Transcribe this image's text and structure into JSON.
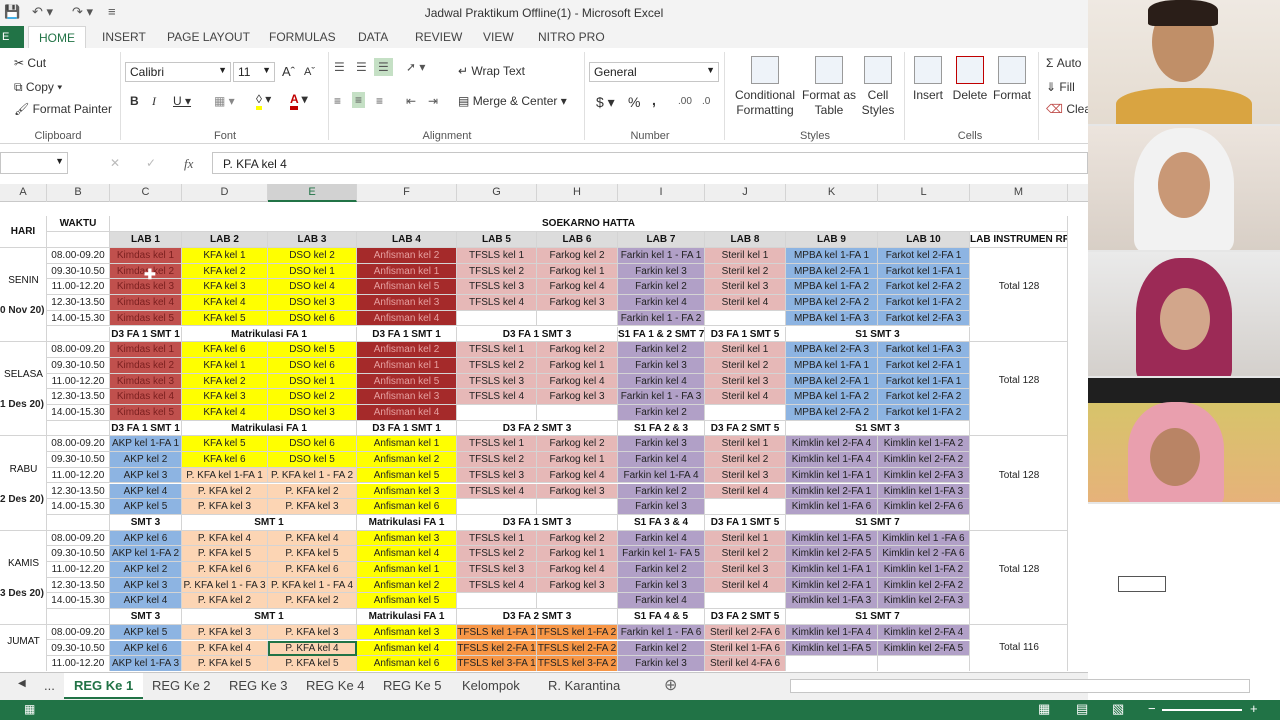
{
  "window": {
    "title": "Jadwal Praktikum Offline(1) - Microsoft Excel"
  },
  "tabs": [
    "HOME",
    "INSERT",
    "PAGE LAYOUT",
    "FORMULAS",
    "DATA",
    "REVIEW",
    "VIEW",
    "NITRO PRO"
  ],
  "file_tab": "E",
  "ribbon": {
    "cut": "Cut",
    "copy": "Copy",
    "format_painter": "Format Painter",
    "font": "Calibri",
    "size": "11",
    "wrap": "Wrap Text",
    "merge": "Merge & Center",
    "number_format": "General",
    "conditional": "Conditional Formatting",
    "format_table": "Format as Table",
    "cell_styles": "Cell Styles",
    "insert": "Insert",
    "delete": "Delete",
    "format": "Format",
    "autosum": "Auto",
    "fill": "Fill",
    "clear": "Clea",
    "groups": {
      "clipboard": "Clipboard",
      "font": "Font",
      "alignment": "Alignment",
      "number": "Number",
      "styles": "Styles",
      "cells": "Cells"
    }
  },
  "formula_bar": {
    "fx": "fx",
    "value": "P. KFA kel 4"
  },
  "columns": [
    "A",
    "B",
    "C",
    "D",
    "E",
    "F",
    "G",
    "H",
    "I",
    "J",
    "K",
    "L",
    "M"
  ],
  "header": {
    "hari": "HARI",
    "waktu": "WAKTU",
    "campus": "SOEKARNO HATTA",
    "labs": [
      "LAB 1",
      "LAB 2",
      "LAB 3",
      "LAB 4",
      "LAB 5",
      "LAB 6",
      "LAB 7",
      "LAB 8",
      "LAB 9",
      "LAB 10",
      "LAB INSTRUMEN RF"
    ]
  },
  "times": [
    "08.00-09.20",
    "09.30-10.50",
    "11.00-12.20",
    "12.30-13.50",
    "14.00-15.30"
  ],
  "days": [
    {
      "name": "SENIN",
      "date": "0 Nov 20)",
      "total": "Total 128",
      "rows": [
        [
          "Kimdas kel 1",
          "KFA kel 1",
          "DSO kel 2",
          "Anfisman kel 2",
          "TFSLS kel 1",
          "Farkog kel 2",
          "Farkin kel 1 - FA 1",
          "Steril kel 1",
          "MPBA kel 1-FA 1",
          "Farkot kel 2-FA 1"
        ],
        [
          "Kimdas kel 2",
          "KFA kel 2",
          "DSO kel 1",
          "Anfisman kel 1",
          "TFSLS kel 2",
          "Farkog kel 1",
          "Farkin kel 3",
          "Steril kel 2",
          "MPBA kel 2-FA 1",
          "Farkot kel 1-FA 1"
        ],
        [
          "Kimdas kel 3",
          "KFA kel 3",
          "DSO kel 4",
          "Anfisman kel 5",
          "TFSLS kel 3",
          "Farkog kel 4",
          "Farkin kel 2",
          "Steril kel 3",
          "MPBA kel 1-FA 2",
          "Farkot kel 2-FA 2"
        ],
        [
          "Kimdas kel 4",
          "KFA kel 4",
          "DSO kel 3",
          "Anfisman kel 3",
          "TFSLS kel 4",
          "Farkog kel 3",
          "Farkin kel 4",
          "Steril kel 4",
          "MPBA kel 2-FA 2",
          "Farkot kel 1-FA 2"
        ],
        [
          "Kimdas kel 5",
          "KFA kel 5",
          "DSO kel 6",
          "Anfisman kel 4",
          "",
          "",
          "Farkin kel 1 - FA 2",
          "",
          "MPBA kel 1-FA 3",
          "Farkot kel 2-FA 3"
        ]
      ],
      "footer": [
        "D3 FA 1 SMT 1",
        "Matrikulasi FA 1",
        "D3 FA 1 SMT 1",
        "D3 FA 1 SMT 3",
        "S1 FA 1 & 2 SMT 7",
        "D3 FA 1 SMT 5",
        "S1 SMT 3"
      ]
    },
    {
      "name": "SELASA",
      "date": "1 Des 20)",
      "total": "Total 128",
      "rows": [
        [
          "Kimdas kel 1",
          "KFA kel 6",
          "DSO kel 5",
          "Anfisman kel 2",
          "TFSLS kel 1",
          "Farkog kel 2",
          "Farkin kel 2",
          "Steril kel 1",
          "MPBA kel 2-FA 3",
          "Farkot kel 1-FA 3"
        ],
        [
          "Kimdas kel 2",
          "KFA kel 1",
          "DSO kel 6",
          "Anfisman kel 1",
          "TFSLS kel 2",
          "Farkog kel 1",
          "Farkin kel 3",
          "Steril kel 2",
          "MPBA kel 1-FA 1",
          "Farkot kel 2-FA 1"
        ],
        [
          "Kimdas kel 3",
          "KFA kel 2",
          "DSO kel 1",
          "Anfisman kel 5",
          "TFSLS kel 3",
          "Farkog kel 4",
          "Farkin kel 4",
          "Steril kel 3",
          "MPBA kel 2-FA 1",
          "Farkot kel 1-FA 1"
        ],
        [
          "Kimdas kel 4",
          "KFA kel 3",
          "DSO kel 2",
          "Anfisman kel 3",
          "TFSLS kel 4",
          "Farkog kel 3",
          "Farkin kel 1 - FA 3",
          "Steril kel 4",
          "MPBA kel 1-FA 2",
          "Farkot kel 2-FA 2"
        ],
        [
          "Kimdas kel 5",
          "KFA kel 4",
          "DSO kel 3",
          "Anfisman kel 4",
          "",
          "",
          "Farkin kel 2",
          "",
          "MPBA kel 2-FA 2",
          "Farkot kel 1-FA 2"
        ]
      ],
      "footer": [
        "D3 FA 1 SMT 1",
        "Matrikulasi FA 1",
        "D3 FA 1 SMT 1",
        "D3 FA 2 SMT 3",
        "S1 FA 2 & 3",
        "D3 FA 2 SMT 5",
        "S1 SMT 3"
      ]
    },
    {
      "name": "RABU",
      "date": "2 Des 20)",
      "total": "Total 128",
      "rows": [
        [
          "AKP kel 1-FA 1",
          "KFA kel 5",
          "DSO kel 6",
          "Anfisman kel 1",
          "TFSLS kel 1",
          "Farkog kel 2",
          "Farkin kel 3",
          "Steril kel 1",
          "Kimklin kel 2-FA 4",
          "Kimklin kel 1-FA 2"
        ],
        [
          "AKP kel 2",
          "KFA kel 6",
          "DSO kel 5",
          "Anfisman kel 2",
          "TFSLS kel 2",
          "Farkog kel 1",
          "Farkin kel 4",
          "Steril kel 2",
          "Kimklin kel 1-FA 4",
          "Kimklin kel 2-FA 2"
        ],
        [
          "AKP kel 3",
          "P. KFA kel 1-FA 1",
          "P. KFA kel 1 - FA 2",
          "Anfisman kel 5",
          "TFSLS kel 3",
          "Farkog kel 4",
          "Farkin kel 1-FA 4",
          "Steril kel 3",
          "Kimklin kel 1-FA 1",
          "Kimklin kel 2-FA 3"
        ],
        [
          "AKP kel 4",
          "P. KFA kel 2",
          "P. KFA kel 2",
          "Anfisman kel 3",
          "TFSLS kel 4",
          "Farkog kel 3",
          "Farkin kel 2",
          "Steril kel 4",
          "Kimklin kel 2-FA 1",
          "Kimklin kel 1-FA 3"
        ],
        [
          "AKP kel 5",
          "P. KFA kel 3",
          "P. KFA kel 3",
          "Anfisman kel 6",
          "",
          "",
          "Farkin kel 3",
          "",
          "Kimklin kel 1-FA 6",
          "Kimklin kel 2-FA 6"
        ]
      ],
      "footer": [
        "SMT 3",
        "SMT 1",
        "Matrikulasi FA 1",
        "D3 FA 1 SMT 3",
        "S1 FA 3 & 4",
        "D3 FA 1 SMT 5",
        "S1 SMT 7"
      ]
    },
    {
      "name": "KAMIS",
      "date": "3 Des 20)",
      "total": "Total 128",
      "rows": [
        [
          "AKP kel 6",
          "P. KFA kel 4",
          "P. KFA kel 4",
          "Anfisman kel 3",
          "TFSLS kel 1",
          "Farkog kel 2",
          "Farkin kel 4",
          "Steril kel 1",
          "Kimklin kel 1-FA 5",
          "Kimklin kel 1 -FA 6"
        ],
        [
          "AKP kel 1-FA 2",
          "P. KFA kel 5",
          "P. KFA kel 5",
          "Anfisman kel 4",
          "TFSLS kel 2",
          "Farkog kel 1",
          "Farkin kel 1- FA 5",
          "Steril kel 2",
          "Kimklin kel 2-FA 5",
          "Kimklin kel 2 -FA 6"
        ],
        [
          "AKP kel 2",
          "P. KFA kel 6",
          "P. KFA kel 6",
          "Anfisman kel 1",
          "TFSLS kel 3",
          "Farkog kel 4",
          "Farkin kel 2",
          "Steril kel 3",
          "Kimklin kel 1-FA 1",
          "Kimklin kel 1-FA 2"
        ],
        [
          "AKP kel 3",
          "P. KFA kel 1 - FA 3",
          "P. KFA kel 1 - FA 4",
          "Anfisman kel 2",
          "TFSLS kel 4",
          "Farkog kel 3",
          "Farkin kel 3",
          "Steril kel 4",
          "Kimklin kel 2-FA 1",
          "Kimklin kel 2-FA 2"
        ],
        [
          "AKP kel 4",
          "P. KFA kel 2",
          "P. KFA kel 2",
          "Anfisman kel 5",
          "",
          "",
          "Farkin kel 4",
          "",
          "Kimklin kel 1-FA 3",
          "Kimklin kel 2-FA 3"
        ]
      ],
      "footer": [
        "SMT 3",
        "SMT 1",
        "Matrikulasi FA 1",
        "D3 FA 2 SMT 3",
        "S1 FA 4 & 5",
        "D3 FA 2 SMT 5",
        "S1 SMT 7"
      ]
    },
    {
      "name": "JUMAT",
      "date": "",
      "total": "Total 116",
      "rows": [
        [
          "AKP kel 5",
          "P. KFA kel 3",
          "P. KFA kel 3",
          "Anfisman kel 3",
          "TFSLS kel 1-FA 1",
          "TFSLS kel 1-FA 2",
          "Farkin kel 1 - FA 6",
          "Steril kel 2-FA 6",
          "Kimklin kel 1-FA 4",
          "Kimklin kel 2-FA 4"
        ],
        [
          "AKP kel 6",
          "P. KFA kel 4",
          "P. KFA kel 4",
          "Anfisman kel 4",
          "TFSLS kel 2-FA 1",
          "TFSLS kel 2-FA 2",
          "Farkin kel 2",
          "Steril kel 1-FA 6",
          "Kimklin kel 1-FA 5",
          "Kimklin kel 2-FA 5"
        ],
        [
          "AKP kel 1-FA 3",
          "P. KFA kel 5",
          "P. KFA kel 5",
          "Anfisman kel 6",
          "TFSLS kel 3-FA 1",
          "TFSLS kel 3-FA 2",
          "Farkin kel 3",
          "Steril kel 4-FA 6",
          "",
          ""
        ]
      ],
      "footer": []
    }
  ],
  "sheet_tabs": [
    "...",
    "REG Ke 1",
    "REG Ke 2",
    "REG Ke 3",
    "REG Ke 4",
    "REG Ke 5",
    "Kelompok",
    "R. Karantina"
  ],
  "colors": {
    "green": "#217346",
    "red": "#c0504d",
    "redText": "#7a1f1f",
    "yellow": "#ffff00",
    "pink": "#e6b8b7",
    "purple": "#b1a0c7",
    "blue": "#8db4e2",
    "salmon": "#fcd5b4",
    "orange": "#f79646",
    "white": "#ffffff"
  }
}
